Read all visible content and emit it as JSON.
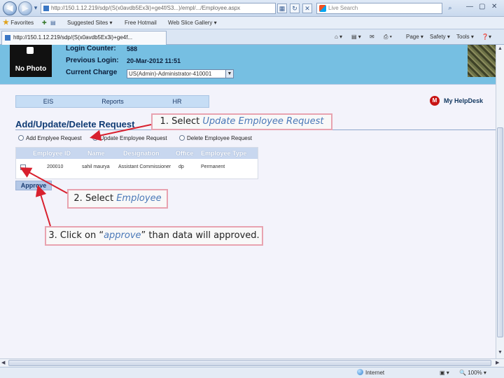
{
  "browser": {
    "url": "http://150.1.12.219/sdp/(S(x0avdb5Ex3i)+ge4f/S3...)/empl/.../Employee.aspx",
    "search_placeholder": "Live Search",
    "fav_label": "Favorites",
    "fav_items": [
      "Suggested Sites ▾",
      "Free Hotmail",
      "Web Slice Gallery ▾"
    ],
    "tab_title": "http://150.1.12.219/sdp/(S(x0avdb5Ex3i)+ge4f...",
    "toolbar": {
      "page": "Page ▾",
      "safety": "Safety ▾",
      "tools": "Tools ▾",
      "help": "❓▾"
    },
    "status_zone": "Internet",
    "zoom": "100%"
  },
  "header": {
    "photo_caption": "No Photo",
    "login_counter_label": "Login Counter:",
    "login_counter_value": "588",
    "previous_login_label": "Previous Login:",
    "previous_login_value": "20-Mar-2012 11:51",
    "current_charge_label": "Current Charge",
    "current_charge_value": "US(Admin)-Administrator-410001"
  },
  "menu": [
    "EIS",
    "Reports",
    "HR"
  ],
  "helpdesk": "My HelpDesk",
  "section_title": "Add/Update/Delete Request",
  "radios": [
    {
      "label": "Add Emplyee Request",
      "selected": false
    },
    {
      "label": "Update Employee Request",
      "selected": true
    },
    {
      "label": "Delete Employee Request",
      "selected": false
    }
  ],
  "table": {
    "headers": [
      "Employee ID",
      "Name",
      "Designation",
      "Office",
      "Employee Type"
    ],
    "row": [
      "200010",
      "sahil maurya",
      "Assistant Commissioner",
      "dp",
      "Permanent"
    ]
  },
  "approve_label": "Approve",
  "callouts": {
    "c1_prefix": "1. Select ",
    "c1_emph": "Update Employee Request",
    "c2_prefix": "2. Select ",
    "c2_emph": "Employee",
    "c3_prefix": "3. Click on “",
    "c3_emph": "approve",
    "c3_suffix": "” than data will approved."
  },
  "colors": {
    "header_band": "#76bfe2",
    "callout_border": "#e8a3b0",
    "arrow": "#d8202e"
  }
}
